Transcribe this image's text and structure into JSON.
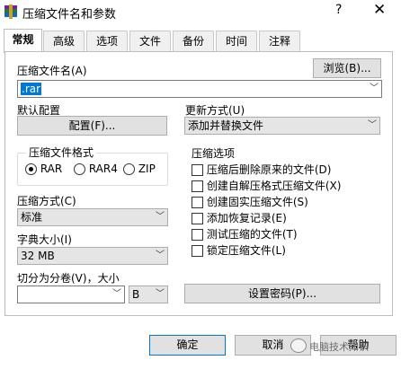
{
  "window": {
    "title": "压缩文件名和参数",
    "help_glyph": "?",
    "close_glyph": "✕"
  },
  "tabs": [
    {
      "label": "常规",
      "active": true
    },
    {
      "label": "高级"
    },
    {
      "label": "选项"
    },
    {
      "label": "文件"
    },
    {
      "label": "备份"
    },
    {
      "label": "时间"
    },
    {
      "label": "注释"
    }
  ],
  "archive_name": {
    "label": "压缩文件名(A)",
    "browse_label": "浏览(B)...",
    "value": ".rar"
  },
  "default_profile": {
    "label": "默认配置",
    "button_label": "配置(F)..."
  },
  "update_mode": {
    "label": "更新方式(U)",
    "value": "添加并替换文件"
  },
  "archive_format": {
    "label": "压缩文件格式",
    "options": [
      {
        "label": "RAR",
        "selected": true
      },
      {
        "label": "RAR4",
        "selected": false
      },
      {
        "label": "ZIP",
        "selected": false
      }
    ]
  },
  "compression_method": {
    "label": "压缩方式(C)",
    "value": "标准"
  },
  "dictionary_size": {
    "label": "字典大小(I)",
    "value": "32 MB"
  },
  "split_volumes": {
    "label": "切分为分卷(V)，大小",
    "value": "",
    "unit": "B"
  },
  "archive_options": {
    "label": "压缩选项",
    "items": [
      "压缩后删除原来的文件(D)",
      "创建自解压格式压缩文件(X)",
      "创建固实压缩文件(S)",
      "添加恢复记录(E)",
      "测试压缩的文件(T)",
      "锁定压缩文件(L)"
    ]
  },
  "set_password_label": "设置密码(P)...",
  "footer": {
    "ok_label": "确定",
    "cancel_label": "取消",
    "help_label": "帮助"
  },
  "watermark_text": "电脑技术知识"
}
